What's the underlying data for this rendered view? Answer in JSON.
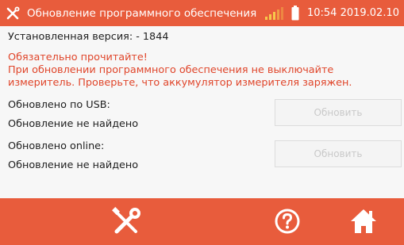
{
  "header": {
    "title": "Обновление программного обеспечения",
    "clock": "10:54 2019.02.10",
    "tools_icon": "wrench-screwdriver-icon",
    "signal_icon": "signal-strength-icon",
    "battery_icon": "battery-icon"
  },
  "content": {
    "installed_version": "Установленная версия: - 1844",
    "warning_title": "Обязательно прочитайте!",
    "warning_line1": "При обновлении программного обеспечения не выключайте",
    "warning_line2": "измеритель. Проверьте, что аккумулятор измерителя заряжен.",
    "usb": {
      "label": "Обновлено по USB:",
      "status": "Обновление не найдено",
      "button": "Обновить"
    },
    "online": {
      "label": "Обновлено online:",
      "status": "Обновление не найдено",
      "button": "Обновить"
    }
  },
  "footer": {
    "icons": [
      "wrench-screwdriver-icon",
      "help-icon",
      "home-icon"
    ]
  },
  "colors": {
    "accent": "#e85c3c",
    "warning_text": "#e0452a",
    "disabled_text": "#c9c9c9"
  }
}
